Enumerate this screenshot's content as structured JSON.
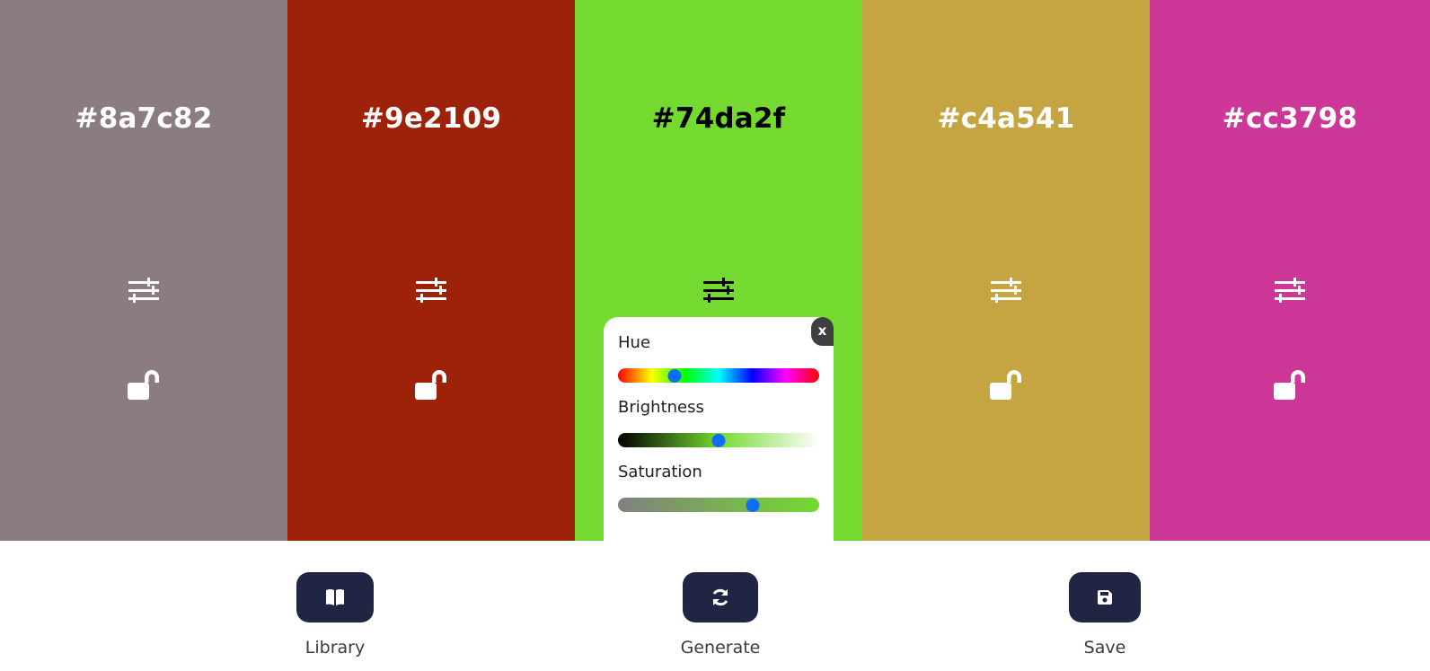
{
  "palette": {
    "colors": [
      {
        "hex": "#8a7c82",
        "text_color": "#ffffff"
      },
      {
        "hex": "#9e2109",
        "text_color": "#ffffff"
      },
      {
        "hex": "#74da2f",
        "text_color": "#000000"
      },
      {
        "hex": "#c4a541",
        "text_color": "#ffffff"
      },
      {
        "hex": "#cc3798",
        "text_color": "#ffffff"
      }
    ],
    "adjust_icon": "sliders-icon",
    "lock_icon": "unlock-icon",
    "open_panel_index": 2
  },
  "adjust_panel": {
    "close_label": "x",
    "hue": {
      "label": "Hue",
      "value": 0.28
    },
    "brightness": {
      "label": "Brightness",
      "value": 0.5
    },
    "saturation": {
      "label": "Saturation",
      "value": 0.67
    }
  },
  "actions": {
    "library": {
      "label": "Library",
      "icon": "book-icon"
    },
    "generate": {
      "label": "Generate",
      "icon": "refresh-icon"
    },
    "save": {
      "label": "Save",
      "icon": "save-icon"
    }
  },
  "colors": {
    "button_bg": "#212544",
    "thumb": "#0d6efd"
  }
}
